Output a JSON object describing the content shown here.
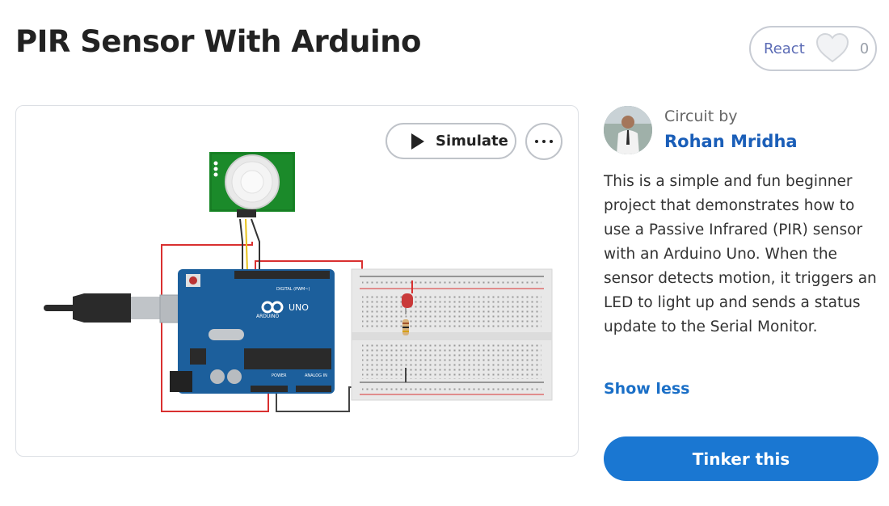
{
  "header": {
    "title": "PIR Sensor With Arduino",
    "react_label": "React",
    "react_count": "0",
    "heart_icon": "heart-outline-icon"
  },
  "canvas": {
    "simulate_label": "Simulate",
    "more_icon": "more-horizontal-icon",
    "components": [
      "PIR sensor",
      "Arduino Uno",
      "Breadboard",
      "LED",
      "Resistor",
      "USB cable"
    ],
    "board_text": {
      "uno": "UNO",
      "arduino": "ARDUINO",
      "digital": "DIGITAL (PWM~)",
      "power": "POWER",
      "analog": "ANALOG IN"
    }
  },
  "author": {
    "circuit_by": "Circuit by",
    "name": "Rohan Mridha"
  },
  "description": "This is a simple and fun beginner project that demonstrates how to use a Passive Infrared (PIR) sensor with an Arduino Uno. When the sensor detects motion, it triggers an LED to light up and sends a status update to the Serial Monitor.",
  "show_less": "Show less",
  "tinker_label": "Tinker this",
  "colors": {
    "accent": "#1a77d2",
    "link": "#1a5eb8",
    "board": "#1c5f9c",
    "pir_board": "#1b8a2a"
  }
}
